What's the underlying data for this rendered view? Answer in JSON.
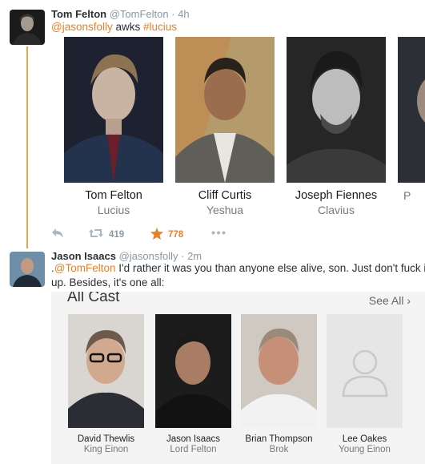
{
  "tweet1": {
    "author_name": "Tom Felton",
    "author_handle": "@TomFelton",
    "dot": "·",
    "time": "4h",
    "mention": "@jasonsfolly",
    "text_middle": " awks ",
    "hashtag": "#lucius",
    "cast": [
      {
        "actor": "Tom Felton",
        "role": "Lucius"
      },
      {
        "actor": "Cliff Curtis",
        "role": "Yeshua"
      },
      {
        "actor": "Joseph Fiennes",
        "role": "Clavius"
      },
      {
        "actor": "",
        "role": "P"
      }
    ],
    "actions": {
      "reply_icon": "reply-icon",
      "retweet_icon": "retweet-icon",
      "retweet_count": "419",
      "favorite_icon": "star-icon",
      "favorite_count": "778",
      "more_icon": "more-icon"
    }
  },
  "tweet2": {
    "author_name": "Jason Isaacs",
    "author_handle": "@jasonsfolly",
    "dot": "·",
    "time": "2m",
    "mention_prefix": ".",
    "mention": "@TomFelton",
    "text_line1_rest": " I'd rather it was you than anyone else alive, son. Just don't fuck it",
    "text_line2": "up. Besides, it's one all:",
    "panel": {
      "title": "All Cast",
      "see_all": "See All ›",
      "cast": [
        {
          "actor": "David Thewlis",
          "role": "King Einon"
        },
        {
          "actor": "Jason Isaacs",
          "role": "Lord Felton"
        },
        {
          "actor": "Brian Thompson",
          "role": "Brok"
        },
        {
          "actor": "Lee Oakes",
          "role": "Young Einon"
        }
      ]
    }
  },
  "colors": {
    "accent": "#e7802b",
    "thread": "#e1a94e",
    "muted": "#8899a6"
  }
}
